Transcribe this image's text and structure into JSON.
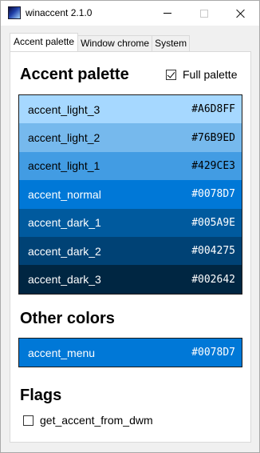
{
  "window": {
    "title": "winaccent 2.1.0"
  },
  "tabs": [
    {
      "label": "Accent palette",
      "active": true
    },
    {
      "label": "Window chrome",
      "active": false
    },
    {
      "label": "System",
      "active": false
    }
  ],
  "accent_section": {
    "heading": "Accent palette",
    "full_palette_label": "Full palette",
    "full_palette_checked": true
  },
  "palette": [
    {
      "name": "accent_light_3",
      "hex": "#A6D8FF",
      "text_color": "#000000"
    },
    {
      "name": "accent_light_2",
      "hex": "#76B9ED",
      "text_color": "#000000"
    },
    {
      "name": "accent_light_1",
      "hex": "#429CE3",
      "text_color": "#000000"
    },
    {
      "name": "accent_normal",
      "hex": "#0078D7",
      "text_color": "#ffffff"
    },
    {
      "name": "accent_dark_1",
      "hex": "#005A9E",
      "text_color": "#ffffff"
    },
    {
      "name": "accent_dark_2",
      "hex": "#004275",
      "text_color": "#ffffff"
    },
    {
      "name": "accent_dark_3",
      "hex": "#002642",
      "text_color": "#ffffff"
    }
  ],
  "other_section": {
    "heading": "Other colors"
  },
  "other_colors": [
    {
      "name": "accent_menu",
      "hex": "#0078D7",
      "text_color": "#ffffff"
    }
  ],
  "flags_section": {
    "heading": "Flags",
    "items": [
      {
        "label": "get_accent_from_dwm",
        "checked": false
      }
    ]
  }
}
